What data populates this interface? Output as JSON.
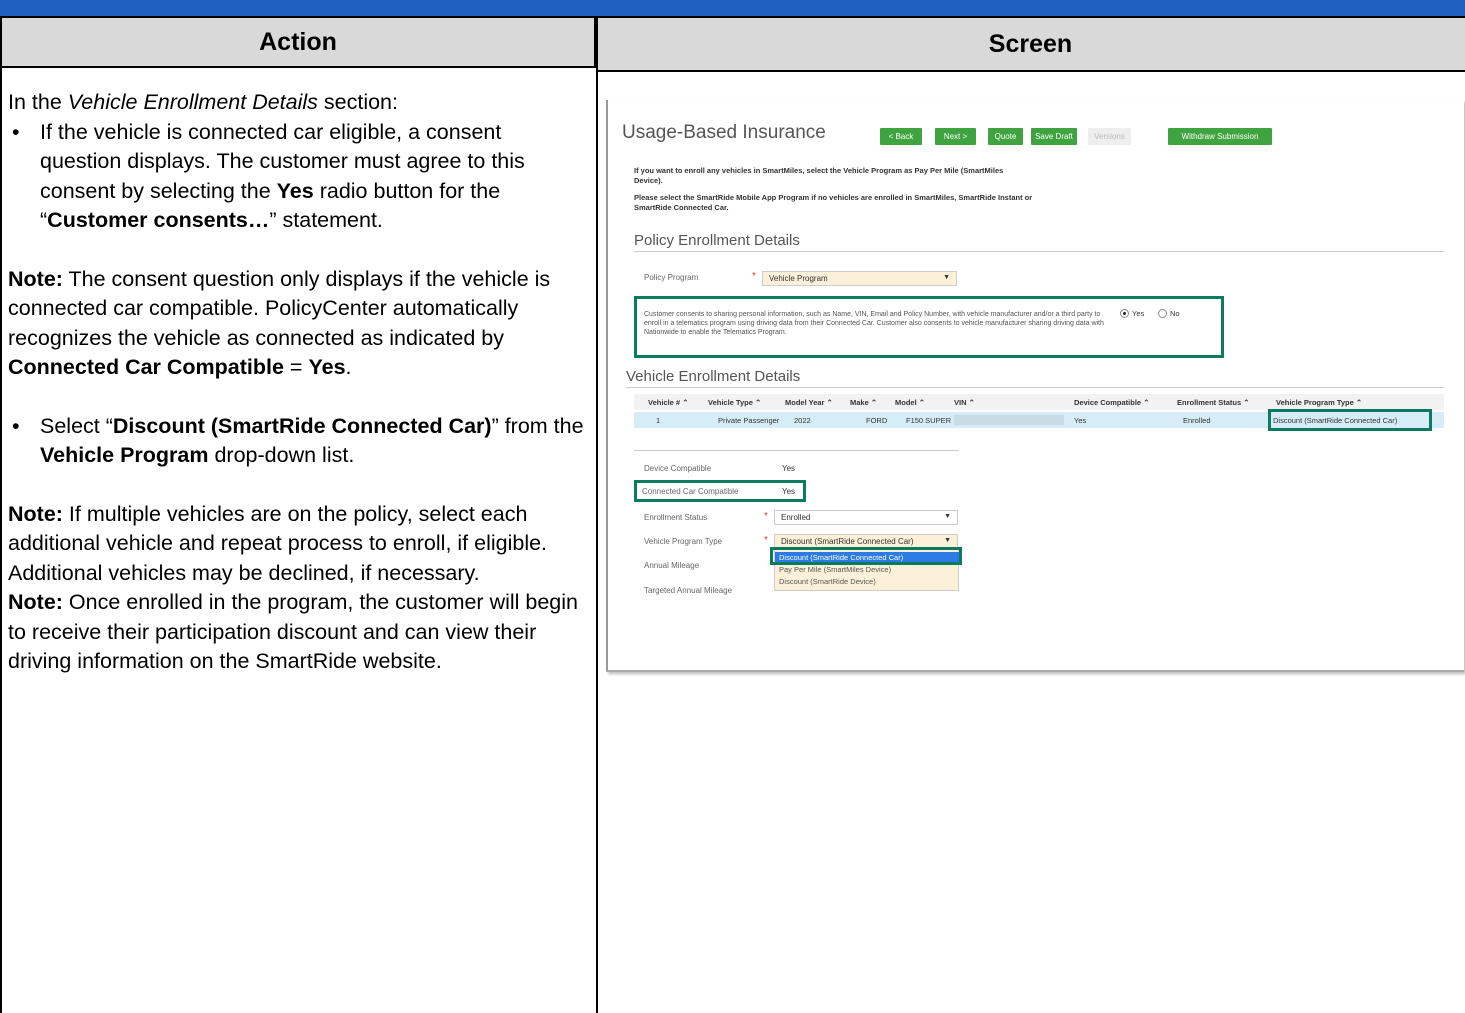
{
  "table": {
    "action_header": "Action",
    "screen_header": "Screen"
  },
  "action": {
    "intro_prefix": "In the ",
    "intro_em": "Vehicle Enrollment Details",
    "intro_suffix": " section:",
    "bullet1_a": "If the vehicle is connected car eligible, a consent question displays. The customer must agree to this consent by selecting the ",
    "bullet1_b": "Yes",
    "bullet1_c": " radio button for the “",
    "bullet1_d": "Customer consents…",
    "bullet1_e": "” statement.",
    "note1_label": "Note:",
    "note1_a": " The consent question only displays if the vehicle is connected car compatible. PolicyCenter automatically recognizes the vehicle as connected as indicated by ",
    "note1_b": "Connected Car Compatible",
    "note1_c": " = ",
    "note1_d": "Yes",
    "note1_e": ".",
    "bullet2_a": "Select “",
    "bullet2_b": "Discount (SmartRide Connected Car)",
    "bullet2_c": "” from the ",
    "bullet2_d": "Vehicle Program",
    "bullet2_e": " drop-down list.",
    "note2_label": "Note:",
    "note2_text": " If multiple vehicles are on the policy, select each additional vehicle and repeat process to enroll, if eligible. Additional vehicles may be declined, if necessary.",
    "note3_label": "Note:",
    "note3_text": " Once enrolled in the program, the customer will begin to receive their participation discount and can view their driving information on the SmartRide website.",
    "bullet_char": "•"
  },
  "screen": {
    "title": "Usage-Based Insurance",
    "buttons": {
      "back": "< Back",
      "next": "Next >",
      "quote": "Quote",
      "save_draft": "Save Draft",
      "versions": "Versions",
      "withdraw": "Withdraw Submission"
    },
    "info1": "If you want to enroll any vehicles in SmartMiles, select the Vehicle Program as Pay Per Mile (SmartMiles Device).",
    "info2": "Please select the SmartRide Mobile App Program if no vehicles are enrolled in SmartMiles, SmartRide Instant or SmartRide Connected Car.",
    "policy_section": "Policy Enrollment Details",
    "policy_program_label": "Policy Program",
    "policy_program_value": "Vehicle Program",
    "consent_text": "Customer consents to sharing personal information, such as Name, VIN, Email and Policy Number, with vehicle manufacturer and/or a third party to enroll in a telematics program using driving data from their Connected Car. Customer also consents to vehicle manufacturer sharing driving data with Nationwide to enable the Telematics Program.",
    "consent_yes": "Yes",
    "consent_no": "No",
    "vehicle_section": "Vehicle Enrollment Details",
    "columns": [
      "Vehicle # ⌃",
      "Vehicle Type ⌃",
      "Model Year ⌃",
      "Make ⌃",
      "Model ⌃",
      "VIN ⌃",
      "Device Compatible ⌃",
      "Enrollment Status ⌃",
      "Vehicle Program Type ⌃"
    ],
    "row": {
      "vehicle_num": "1",
      "vehicle_type": "Private Passenger",
      "model_year": "2022",
      "make": "FORD",
      "model": "F150 SUPER",
      "device_compatible": "Yes",
      "enrollment_status": "Enrolled",
      "program_type": "Discount (SmartRide Connected Car)"
    },
    "details": {
      "device_compatible_label": "Device Compatible",
      "device_compatible_value": "Yes",
      "connected_label": "Connected Car Compatible",
      "connected_value": "Yes",
      "enrollment_label": "Enrollment Status",
      "enrollment_value": "Enrolled",
      "program_type_label": "Vehicle Program Type",
      "program_type_value": "Discount (SmartRide Connected Car)",
      "annual_mileage_label": "Annual Mileage",
      "targeted_mileage_label": "Targeted Annual Mileage",
      "required_mark": "*"
    },
    "dropdown_options": [
      "Discount (SmartRide Connected Car)",
      "Pay Per Mile (SmartMiles Device)",
      "Discount (SmartRide Device)"
    ],
    "colors": {
      "accent_green": "#3fa33f",
      "highlight_box": "#0a7a61",
      "selected_option": "#2c7be5"
    }
  }
}
